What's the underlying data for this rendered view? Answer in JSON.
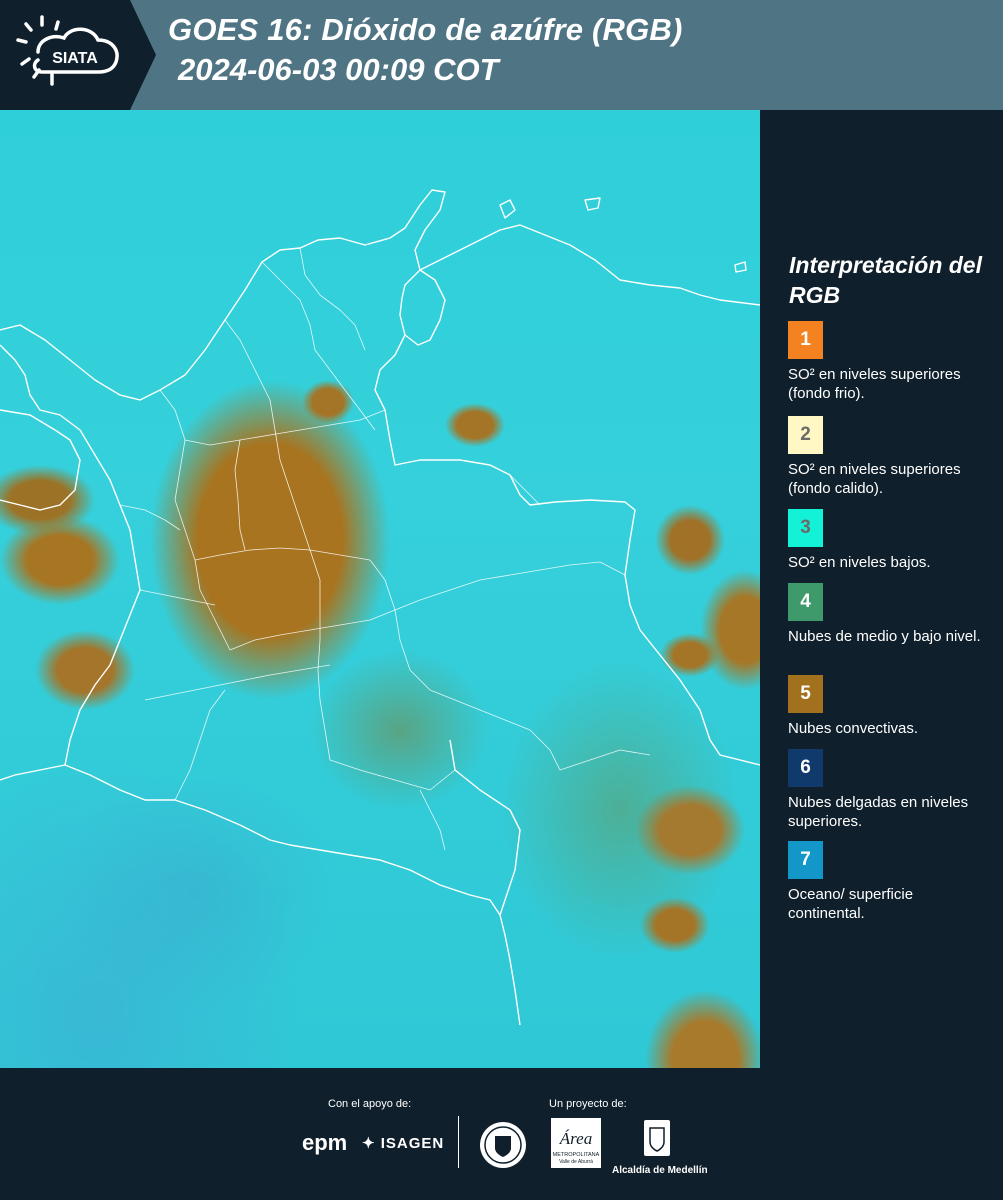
{
  "header": {
    "logo_text": "SIATA",
    "title_line1": "GOES 16: Dióxido de azúfre (RGB)",
    "title_line2": "2024-06-03 00:09 COT"
  },
  "legend": {
    "title": "Interpretación del RGB",
    "items": [
      {
        "number": "1",
        "color": "#f58220",
        "text": "SO² en niveles superiores (fondo frio)."
      },
      {
        "number": "2",
        "color": "#fff8c4",
        "text": "SO² en niveles superiores (fondo calido)."
      },
      {
        "number": "3",
        "color": "#13f2d6",
        "text": "SO² en niveles bajos."
      },
      {
        "number": "4",
        "color": "#3e9a6a",
        "text": "Nubes de medio y bajo nivel."
      },
      {
        "number": "5",
        "color": "#a2711e",
        "text": "Nubes convectivas."
      },
      {
        "number": "6",
        "color": "#103a6b",
        "text": "Nubes delgadas en niveles superiores."
      },
      {
        "number": "7",
        "color": "#1396c8",
        "text": "Oceano/ superficie continental."
      }
    ]
  },
  "footer": {
    "support_label": "Con el apoyo de:",
    "project_label": "Un proyecto de:",
    "epm": "epm",
    "isagen": "ISAGEN",
    "area_text": "Área",
    "area_sub": "METROPOLITANA",
    "area_sub2": "Valle de Aburrá",
    "alcaldia": "Alcaldía de Medellín"
  }
}
